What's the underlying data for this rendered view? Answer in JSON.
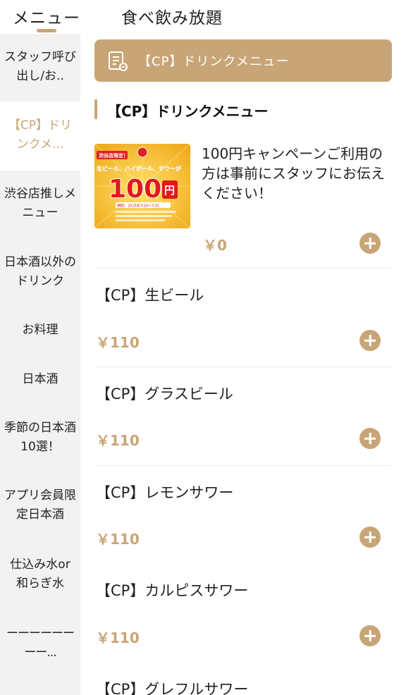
{
  "tabs": {
    "menu": "メニュー",
    "all_you_can_drink": "食べ飲み放題"
  },
  "sidebar": {
    "items": [
      {
        "label": "スタッフ呼び出し/お.."
      },
      {
        "label": "【CP】ドリンクメ..."
      },
      {
        "label": "渋谷店推しメニュー"
      },
      {
        "label": "日本酒以外のドリンク"
      },
      {
        "label": "お料理"
      },
      {
        "label": "日本酒"
      },
      {
        "label": "季節の日本酒10選！"
      },
      {
        "label": "アプリ会員限定日本酒"
      },
      {
        "label": "仕込み水or和らぎ水"
      },
      {
        "label": "ーーーーーーーー..."
      }
    ]
  },
  "category": {
    "banner_label": "【CP】ドリンクメニュー",
    "section_title": "【CP】ドリンクメニュー"
  },
  "promo": {
    "description": "100円キャンペーンご利用の方は事前にスタッフにお伝えください！",
    "price": "￥0",
    "image": {
      "tag": "渋谷店限定！",
      "headline": "生ビール、ハイボール、サワーが",
      "big": "100",
      "unit": "円",
      "period": "期間：2025年7/10～7/31"
    }
  },
  "items": [
    {
      "name": "【CP】生ビール",
      "price": "￥110"
    },
    {
      "name": "【CP】グラスビール",
      "price": "￥110"
    },
    {
      "name": "【CP】レモンサワー",
      "price": "￥110"
    },
    {
      "name": "【CP】カルピスサワー",
      "price": "￥110"
    },
    {
      "name": "【CP】グレフルサワー",
      "price": ""
    }
  ],
  "colors": {
    "accent": "#c8a577",
    "sidebar_bg": "#f2f2f2"
  }
}
